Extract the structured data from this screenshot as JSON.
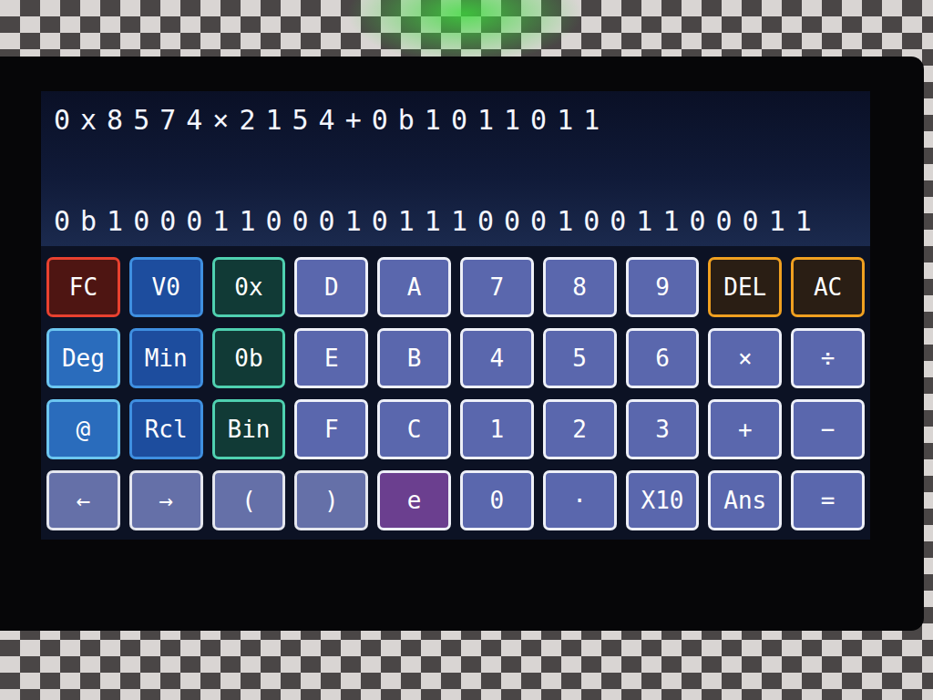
{
  "display": {
    "expression": "0x8574×2154+0b1011011",
    "result": "0b100011000101110001001100011"
  },
  "keys": [
    {
      "label": "FC",
      "kind": "shift"
    },
    {
      "label": "V0",
      "kind": "var"
    },
    {
      "label": "0x",
      "kind": "base"
    },
    {
      "label": "D",
      "kind": "key"
    },
    {
      "label": "A",
      "kind": "key"
    },
    {
      "label": "7",
      "kind": "key"
    },
    {
      "label": "8",
      "kind": "key"
    },
    {
      "label": "9",
      "kind": "key"
    },
    {
      "label": "DEL",
      "kind": "clear"
    },
    {
      "label": "AC",
      "kind": "clear"
    },
    {
      "label": "Deg",
      "kind": "setting"
    },
    {
      "label": "Min",
      "kind": "var"
    },
    {
      "label": "0b",
      "kind": "base"
    },
    {
      "label": "E",
      "kind": "key"
    },
    {
      "label": "B",
      "kind": "key"
    },
    {
      "label": "4",
      "kind": "key"
    },
    {
      "label": "5",
      "kind": "key"
    },
    {
      "label": "6",
      "kind": "key"
    },
    {
      "label": "×",
      "kind": "key"
    },
    {
      "label": "÷",
      "kind": "key"
    },
    {
      "label": "@",
      "kind": "setting"
    },
    {
      "label": "Rcl",
      "kind": "var"
    },
    {
      "label": "Bin",
      "kind": "base"
    },
    {
      "label": "F",
      "kind": "key"
    },
    {
      "label": "C",
      "kind": "key"
    },
    {
      "label": "1",
      "kind": "key"
    },
    {
      "label": "2",
      "kind": "key"
    },
    {
      "label": "3",
      "kind": "key"
    },
    {
      "label": "+",
      "kind": "key"
    },
    {
      "label": "−",
      "kind": "key"
    },
    {
      "label": "←",
      "kind": "nav"
    },
    {
      "label": "→",
      "kind": "nav"
    },
    {
      "label": "(",
      "kind": "nav"
    },
    {
      "label": ")",
      "kind": "nav"
    },
    {
      "label": "e",
      "kind": "exp"
    },
    {
      "label": "0",
      "kind": "key"
    },
    {
      "label": "·",
      "kind": "key"
    },
    {
      "label": "X10",
      "kind": "key"
    },
    {
      "label": "Ans",
      "kind": "key"
    },
    {
      "label": "=",
      "kind": "key"
    }
  ]
}
